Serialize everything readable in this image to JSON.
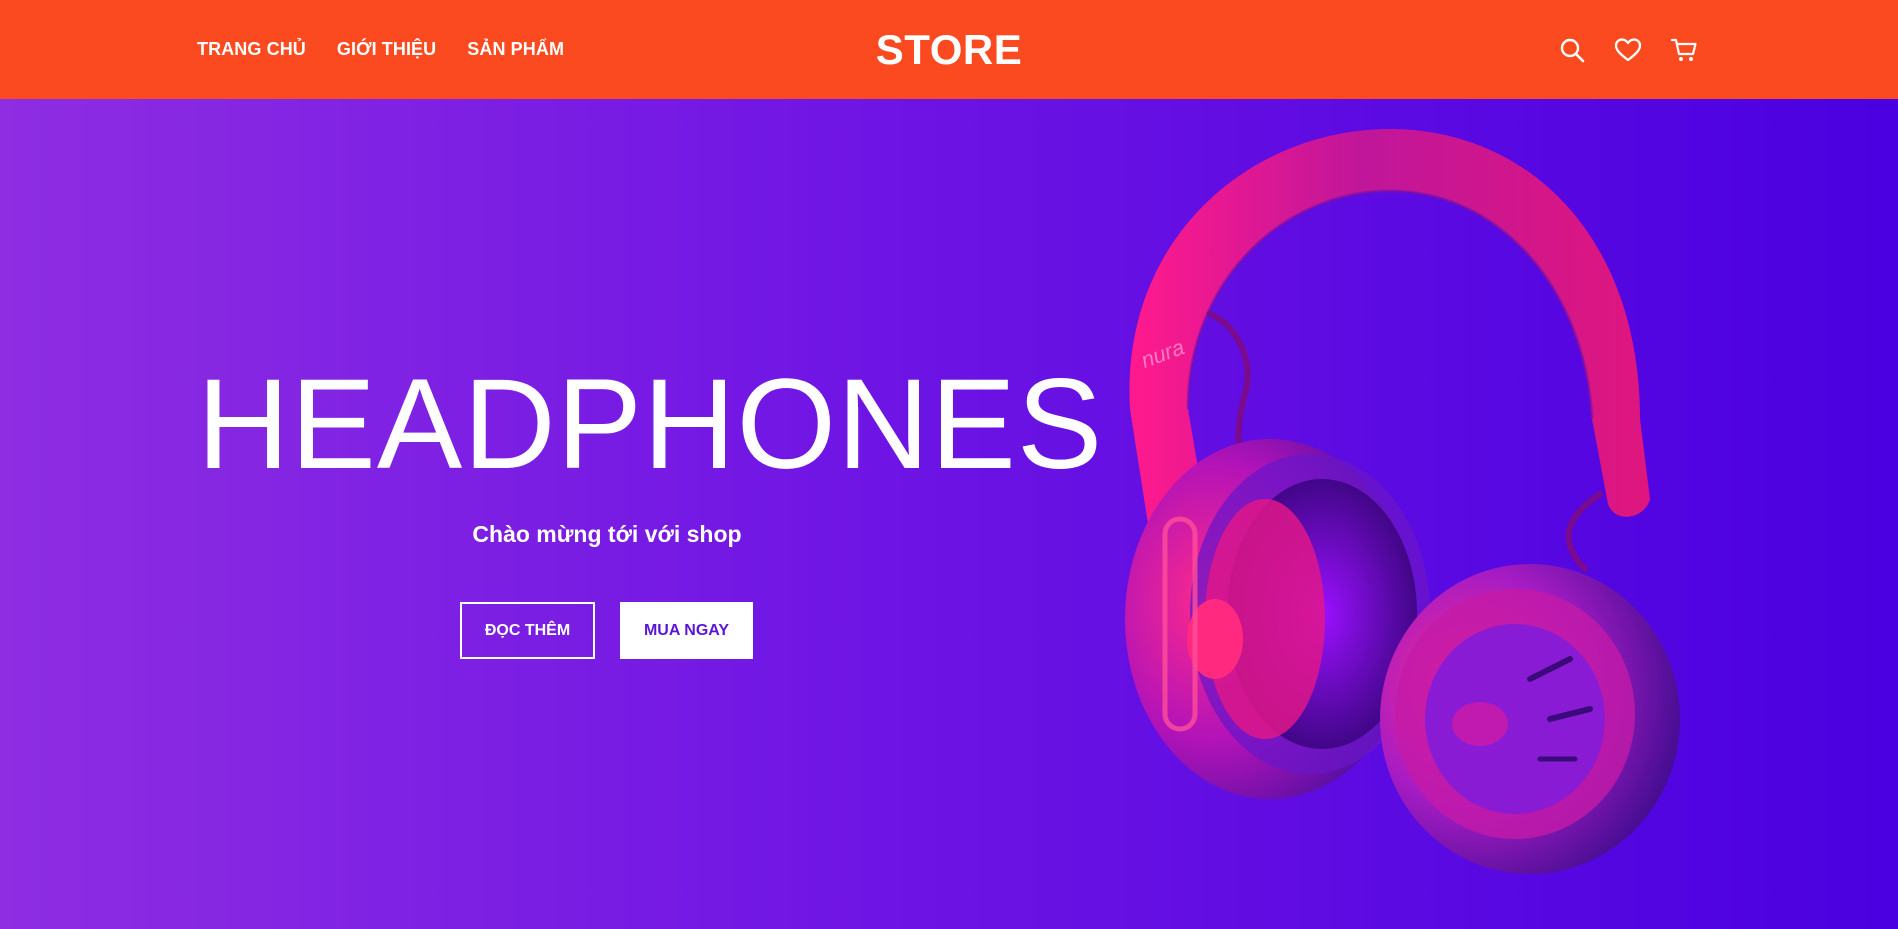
{
  "header": {
    "nav": [
      {
        "label": "TRANG CHỦ"
      },
      {
        "label": "GIỚI THIỆU"
      },
      {
        "label": "SẢN PHẨM"
      }
    ],
    "brand": "STORE",
    "icons": [
      "search-icon",
      "heart-icon",
      "cart-icon"
    ],
    "background": "#fb4a1f"
  },
  "hero": {
    "title": "HEADPHONES",
    "subtitle": "Chào mừng tới với shop",
    "buttons": {
      "read_more": "ĐỌC THÊM",
      "buy_now": "MUA NGAY"
    },
    "product_brand": "nura",
    "gradient": [
      "#8e2de2",
      "#4a00e0"
    ]
  }
}
